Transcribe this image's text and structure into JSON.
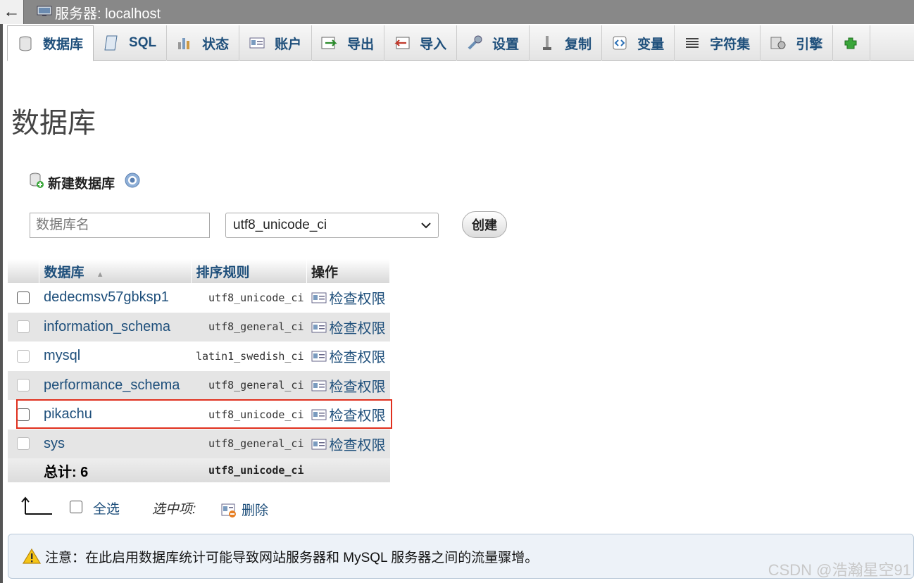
{
  "topbar": {
    "back_symbol": "←",
    "server_label": "服务器: localhost"
  },
  "tabs": [
    {
      "label": "数据库",
      "icon": "database-icon",
      "active": true
    },
    {
      "label": "SQL",
      "icon": "sql-icon"
    },
    {
      "label": "状态",
      "icon": "status-icon"
    },
    {
      "label": "账户",
      "icon": "accounts-icon"
    },
    {
      "label": "导出",
      "icon": "export-icon"
    },
    {
      "label": "导入",
      "icon": "import-icon"
    },
    {
      "label": "设置",
      "icon": "settings-icon"
    },
    {
      "label": "复制",
      "icon": "replication-icon"
    },
    {
      "label": "变量",
      "icon": "variables-icon"
    },
    {
      "label": "字符集",
      "icon": "charset-icon"
    },
    {
      "label": "引擎",
      "icon": "engines-icon"
    },
    {
      "label": "",
      "icon": "plugins-icon"
    }
  ],
  "page_title": "数据库",
  "create_db": {
    "heading": "新建数据库",
    "name_placeholder": "数据库名",
    "collation_selected": "utf8_unicode_ci",
    "create_button": "创建"
  },
  "table": {
    "headers": {
      "database": "数据库",
      "sort_indicator": "▲",
      "collation": "排序规则",
      "action": "操作"
    },
    "rows": [
      {
        "name": "dedecmsv57gbksp1",
        "collation": "utf8_unicode_ci",
        "action": "检查权限"
      },
      {
        "name": "information_schema",
        "collation": "utf8_general_ci",
        "action": "检查权限"
      },
      {
        "name": "mysql",
        "collation": "latin1_swedish_ci",
        "action": "检查权限"
      },
      {
        "name": "performance_schema",
        "collation": "utf8_general_ci",
        "action": "检查权限"
      },
      {
        "name": "pikachu",
        "collation": "utf8_unicode_ci",
        "action": "检查权限"
      },
      {
        "name": "sys",
        "collation": "utf8_general_ci",
        "action": "检查权限"
      }
    ],
    "footer": {
      "total": "总计: 6",
      "collation": "utf8_unicode_ci"
    }
  },
  "bulk": {
    "select_all": "全选",
    "with_selected": "选中项:",
    "delete": "删除"
  },
  "notice": "注意：在此启用数据库统计可能导致网站服务器和 MySQL 服务器之间的流量骤增。",
  "watermark": "CSDN @浩瀚星空91",
  "colors": {
    "link": "#1e4f7b",
    "highlight": "#e0301e",
    "topbar": "#888888"
  }
}
